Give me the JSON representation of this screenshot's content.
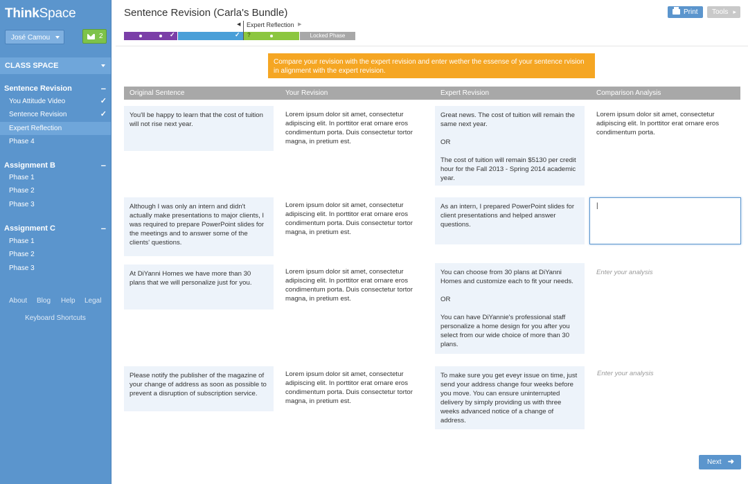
{
  "brand": {
    "bold": "Think",
    "light": "Space"
  },
  "user": {
    "name": "José Camou"
  },
  "messages": {
    "count": "2"
  },
  "sidebar": {
    "class_space": "CLASS SPACE",
    "sections": [
      {
        "title": "Sentence Revision",
        "items": [
          {
            "label": "You Attitude Video",
            "checked": "✓"
          },
          {
            "label": "Sentence Revision",
            "checked": "✓"
          },
          {
            "label": "Expert Reflection",
            "checked": ""
          },
          {
            "label": "Phase 4",
            "checked": ""
          }
        ]
      },
      {
        "title": "Assignment B",
        "items": [
          {
            "label": "Phase 1"
          },
          {
            "label": "Phase 2"
          },
          {
            "label": "Phase 3"
          }
        ]
      },
      {
        "title": "Assignment C",
        "items": [
          {
            "label": "Phase 1"
          },
          {
            "label": "Phase 2"
          },
          {
            "label": "Phase 3"
          }
        ]
      }
    ],
    "footer_links": [
      "About",
      "Blog",
      "Help",
      "Legal"
    ],
    "shortcuts": "Keyboard Shortcuts"
  },
  "header": {
    "title": "Sentence Revision (Carla's Bundle)",
    "print": "Print",
    "tools": "Tools"
  },
  "phase": {
    "current": "Expert Reflection",
    "locked": "Locked Phase",
    "colors": {
      "purple": "#7b3fa8",
      "blue": "#4a9fd8",
      "green": "#8cc63f",
      "gray": "#a8a8a8"
    }
  },
  "instruction": "Compare your revision with the expert revision and enter wether the essense of your sentence rvision in alignment with the expert revision.",
  "table": {
    "headers": [
      "Original Sentence",
      "Your Revision",
      "Expert Revision",
      "Comparison Analysis"
    ],
    "rows": [
      {
        "original": "You'll be happy to learn that the cost of tuition will not rise next year.",
        "revision": "Lorem ipsum dolor sit amet, consectetur adipiscing elit. In porttitor erat ornare eros condimentum porta. Duis consectetur tortor magna, in pretium est.",
        "expert": [
          "Great news. The cost of tuition will remain the same next year.",
          "OR",
          "The cost of tuition will remain $5130 per credit hour for the Fall 2013 - Spring 2014 academic year."
        ],
        "analysis": "Lorem ipsum dolor sit amet, consectetur adipiscing elit. In porttitor erat ornare eros condimentum porta."
      },
      {
        "original": "Although I was only an intern and didn't actually make presentations to major clients, I was required to prepare PowerPoint slides for the meetings and to answer some of the clients' questions.",
        "revision": "Lorem ipsum dolor sit amet, consectetur adipiscing elit. In porttitor erat ornare eros condimentum porta. Duis consectetur tortor magna, in pretium est.",
        "expert": [
          "As an intern, I prepared PowerPoint slides for client presentations and helped answer questions."
        ],
        "analysis_value": "|"
      },
      {
        "original": "At DiYanni Homes we have more than 30 plans that we will personalize just for you.",
        "revision": "Lorem ipsum dolor sit amet, consectetur adipiscing elit. In porttitor erat ornare eros condimentum porta. Duis consectetur tortor magna, in pretium est.",
        "expert": [
          "You can choose from 30 plans at DiYanni Homes and customize each to fit your needs.",
          "OR",
          "You can have DiYannie's professional staff personalize a home design for you after you select from our wide choice of more than 30 plans."
        ],
        "analysis_placeholder": "Enter your analysis"
      },
      {
        "original": "Please notify the publisher of the magazine of your change of address as soon as possible to prevent a disruption of subscription service.",
        "revision": "Lorem ipsum dolor sit amet, consectetur adipiscing elit. In porttitor erat ornare eros condimentum porta. Duis consectetur tortor magna, in pretium est.",
        "expert": [
          "To make sure you get eveyr issue on time, just send your address change four weeks before you move. You can ensure uninterrupted delivery by simply providing us with three weeks advanced notice of a change of address."
        ],
        "analysis_placeholder": "Enter your analysis"
      }
    ]
  },
  "next": "Next"
}
